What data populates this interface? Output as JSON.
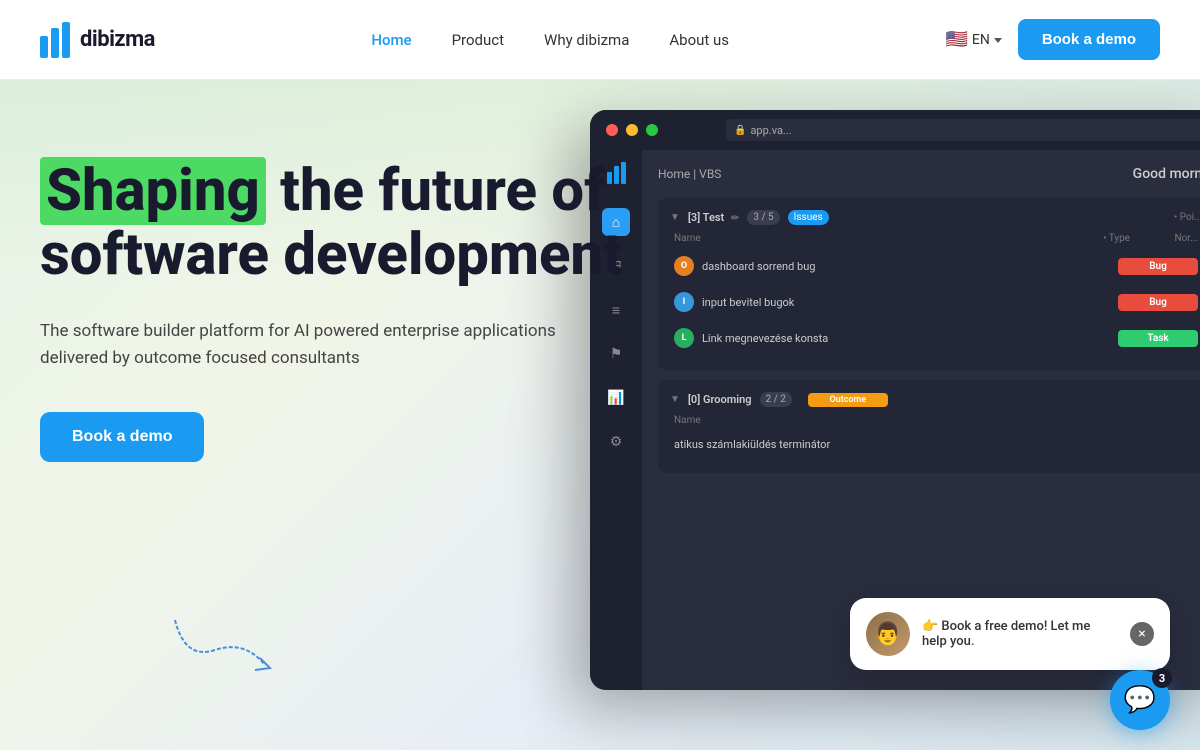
{
  "navbar": {
    "logo_text": "dibizma",
    "links": [
      {
        "label": "Home",
        "active": true
      },
      {
        "label": "Product",
        "active": false
      },
      {
        "label": "Why dibizma",
        "active": false
      },
      {
        "label": "About us",
        "active": false
      }
    ],
    "lang": "EN",
    "cta": "Book a demo"
  },
  "hero": {
    "title_highlight": "Shaping",
    "title_rest": " the future of software development",
    "subtitle": "The software builder platform for AI powered enterprise applications delivered by outcome focused consultants",
    "cta": "Book a demo"
  },
  "app_screenshot": {
    "address": "app.va...",
    "breadcrumb": "Home | VBS",
    "greeting": "Good morn...",
    "sprint_name": "[3] Test",
    "sprint_count": "3 / 5",
    "issues_label": "Issues",
    "col_name": "Name",
    "col_type": "• Type",
    "col_extra": "Nor...",
    "tasks": [
      {
        "initials": "O",
        "color": "#e67e22",
        "name": "dashboard sorrend bug",
        "tag": "Bug",
        "tag_type": "bug"
      },
      {
        "initials": "I",
        "color": "#3498db",
        "name": "input bevitel bugok",
        "tag": "Bug",
        "tag_type": "bug"
      },
      {
        "initials": "L",
        "color": "#27ae60",
        "name": "Link megnevezése konsta",
        "tag": "Task",
        "tag_type": "task"
      }
    ],
    "grooming_name": "[0] Grooming",
    "grooming_count": "2 / 2",
    "outcome_label": "Outcome",
    "grooming_task": "atikus számlakiüldés terminátor"
  },
  "chat": {
    "message": "👉 Book a free demo! Let me help you.",
    "close": "×"
  },
  "intercom": {
    "badge": "3"
  }
}
